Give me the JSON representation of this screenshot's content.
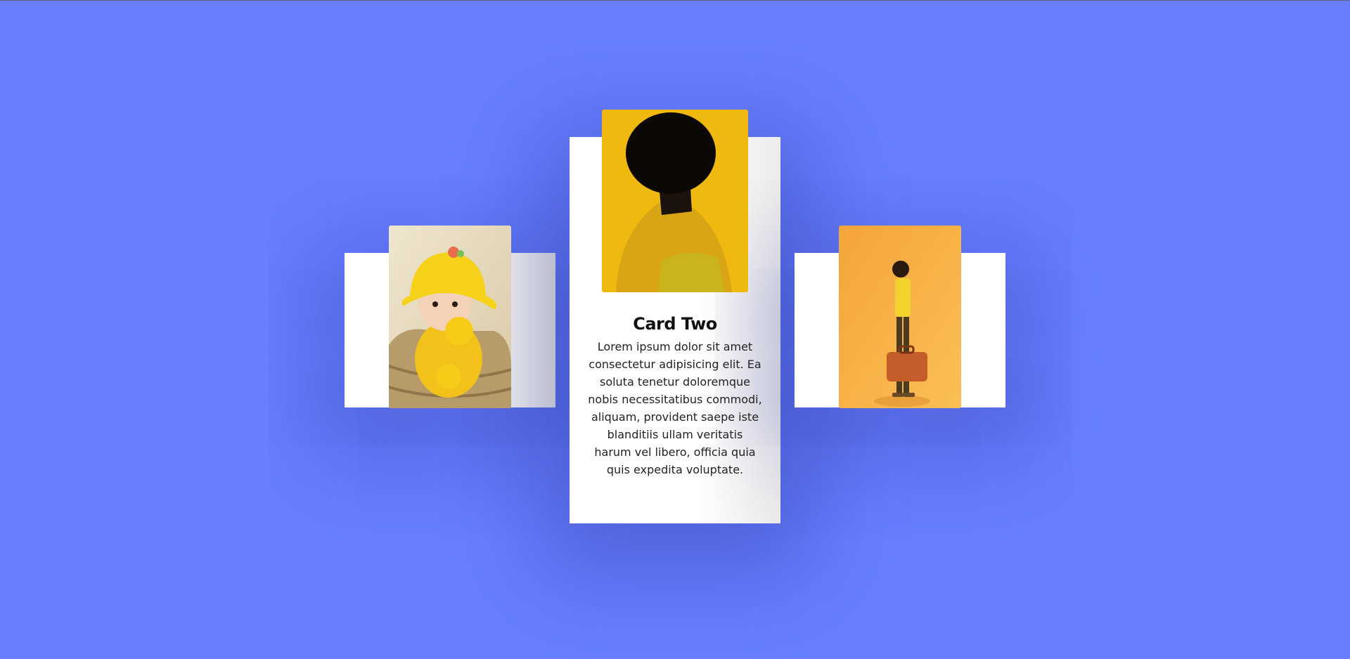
{
  "page": {
    "background_color": "#667eff"
  },
  "cards": [
    {
      "photo": "baby-yellow-hat-photo"
    },
    {
      "photo": "woman-profile-yellow-photo",
      "title": "Card Two",
      "text": "Lorem ipsum dolor sit amet consectetur adipisicing elit. Ea soluta tenetur doloremque nobis necessitatibus commodi, aliquam, provident saepe iste blanditiis ullam veritatis harum vel libero, officia quia quis expedita voluptate."
    },
    {
      "photo": "man-with-suitcase-photo"
    }
  ]
}
